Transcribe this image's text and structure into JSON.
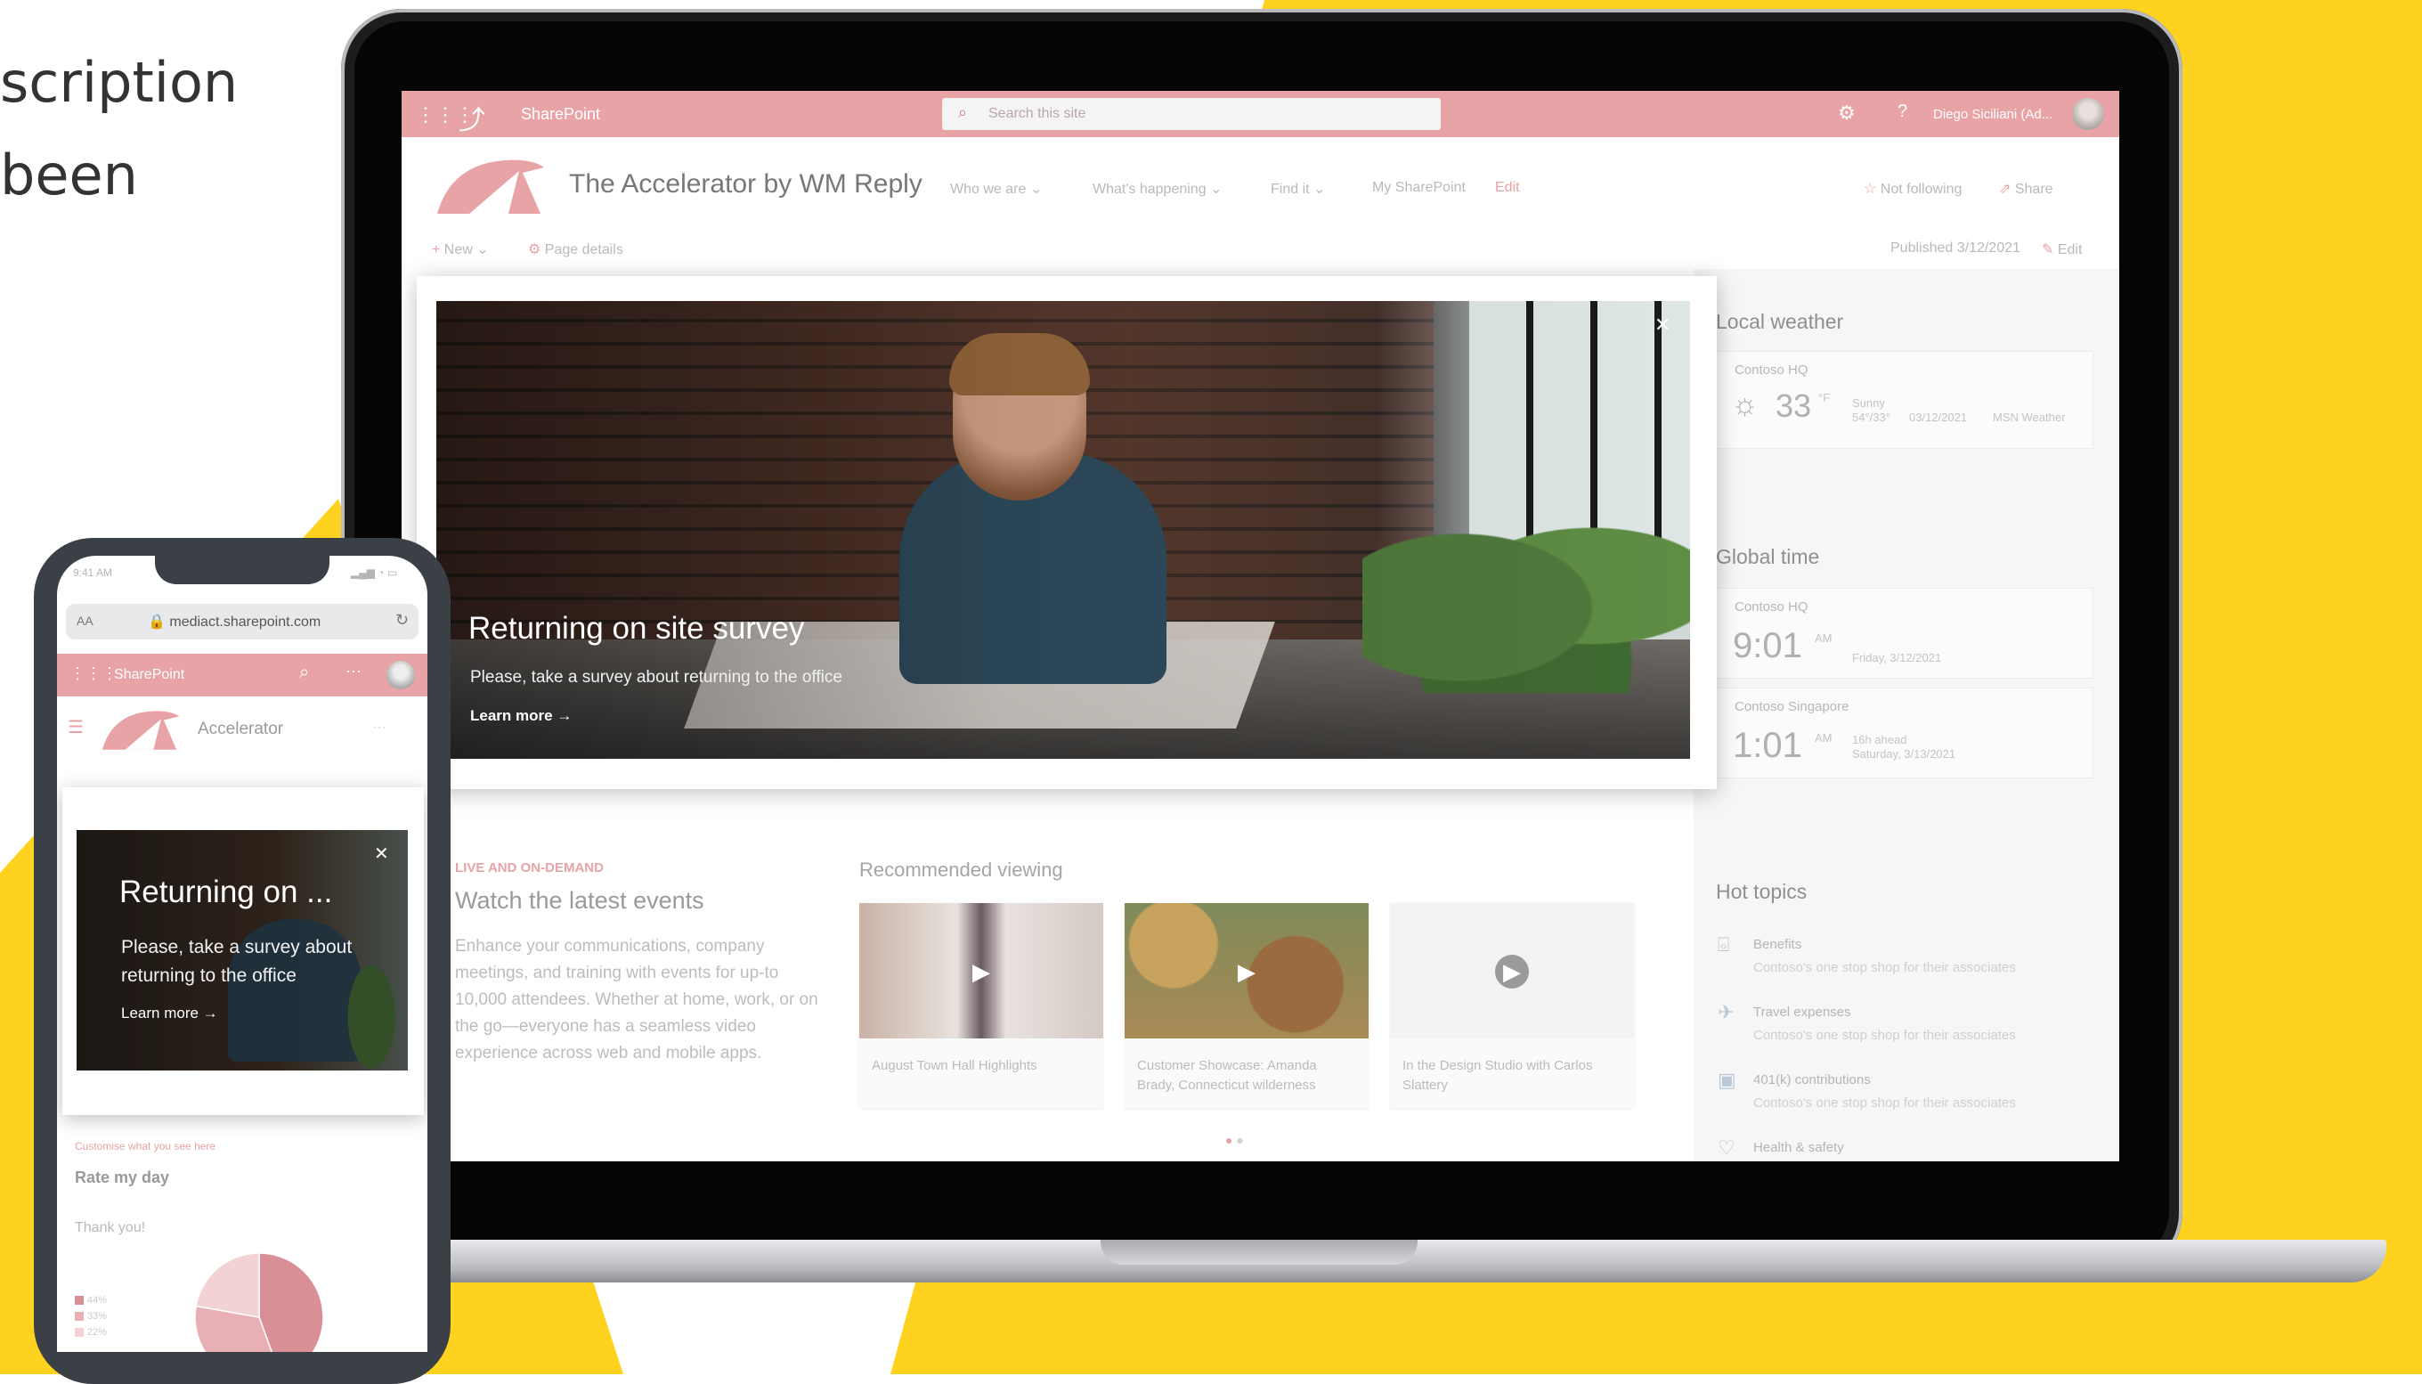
{
  "background": {
    "accent": "#ffd21f"
  },
  "cut_text": [
    "scription",
    "been"
  ],
  "desktop": {
    "suite_bar": {
      "app_name": "SharePoint",
      "search_placeholder": "Search this site",
      "user_name": "Diego Siciliani (Ad...",
      "color": "#e8a3a7"
    },
    "site": {
      "title": "The Accelerator by WM Reply",
      "nav": [
        "Who we are",
        "What's happening",
        "Find it",
        "My SharePoint",
        "Edit"
      ],
      "follow": "Not following",
      "share": "Share"
    },
    "command_bar": {
      "new": "New",
      "page_details": "Page details",
      "published": "Published 3/12/2021",
      "edit": "Edit"
    },
    "hero": {
      "title": "Returning on site survey",
      "subtitle": "Please, take a survey about returning to the office",
      "link": "Learn more"
    },
    "weather": {
      "heading": "Local weather",
      "location": "Contoso HQ",
      "temp": "33",
      "unit": "°F",
      "condition": "Sunny",
      "range": "54°/33°",
      "date": "03/12/2021",
      "source": "MSN Weather"
    },
    "global_time": {
      "heading": "Global time",
      "clocks": [
        {
          "location": "Contoso HQ",
          "time": "9:01",
          "ampm": "AM",
          "detail1": "Friday, 3/12/2021",
          "detail2": ""
        },
        {
          "location": "Contoso Singapore",
          "time": "1:01",
          "ampm": "AM",
          "detail1": "16h ahead",
          "detail2": "Saturday, 3/13/2021"
        }
      ]
    },
    "hot_topics": {
      "heading": "Hot topics",
      "items": [
        {
          "name": "Benefits",
          "desc": "Contoso's one stop shop for their associates",
          "icon": "gift-icon"
        },
        {
          "name": "Travel expenses",
          "desc": "Contoso's one stop shop for their associates",
          "icon": "plane-icon"
        },
        {
          "name": "401(k) contributions",
          "desc": "Contoso's one stop shop for their associates",
          "icon": "money-icon"
        },
        {
          "name": "Health & safety",
          "desc": "",
          "icon": "heart-icon"
        }
      ]
    },
    "events": {
      "eyebrow": "LIVE AND ON-DEMAND",
      "title": "Watch the latest events",
      "body": "Enhance your communications, company meetings, and training with events for up-to 10,000 attendees. Whether at home, work, or on the go—everyone has a seamless video experience across web and mobile apps."
    },
    "recommended": {
      "heading": "Recommended viewing",
      "videos": [
        {
          "caption": "August Town Hall Highlights"
        },
        {
          "caption": "Customer Showcase: Amanda Brady, Connecticut wilderness"
        },
        {
          "caption": "In the Design Studio with Carlos Slattery"
        }
      ]
    }
  },
  "mobile": {
    "status_time": "9:41 AM",
    "url": "mediact.sharepoint.com",
    "aa": "AA",
    "app_name": "SharePoint",
    "site_name": "Accelerator",
    "hero": {
      "title": "Returning on ...",
      "subtitle": "Please, take a survey about returning to the office",
      "link": "Learn more"
    },
    "customise": "Customise what you see here",
    "rate_title": "Rate my day",
    "thanks": "Thank you!",
    "legend": [
      {
        "label": "44%",
        "value": 44,
        "color": "#d98f96"
      },
      {
        "label": "33%",
        "value": 33,
        "color": "#e8b0b4"
      },
      {
        "label": "22%",
        "value": 22,
        "color": "#f2d2d4"
      }
    ]
  }
}
